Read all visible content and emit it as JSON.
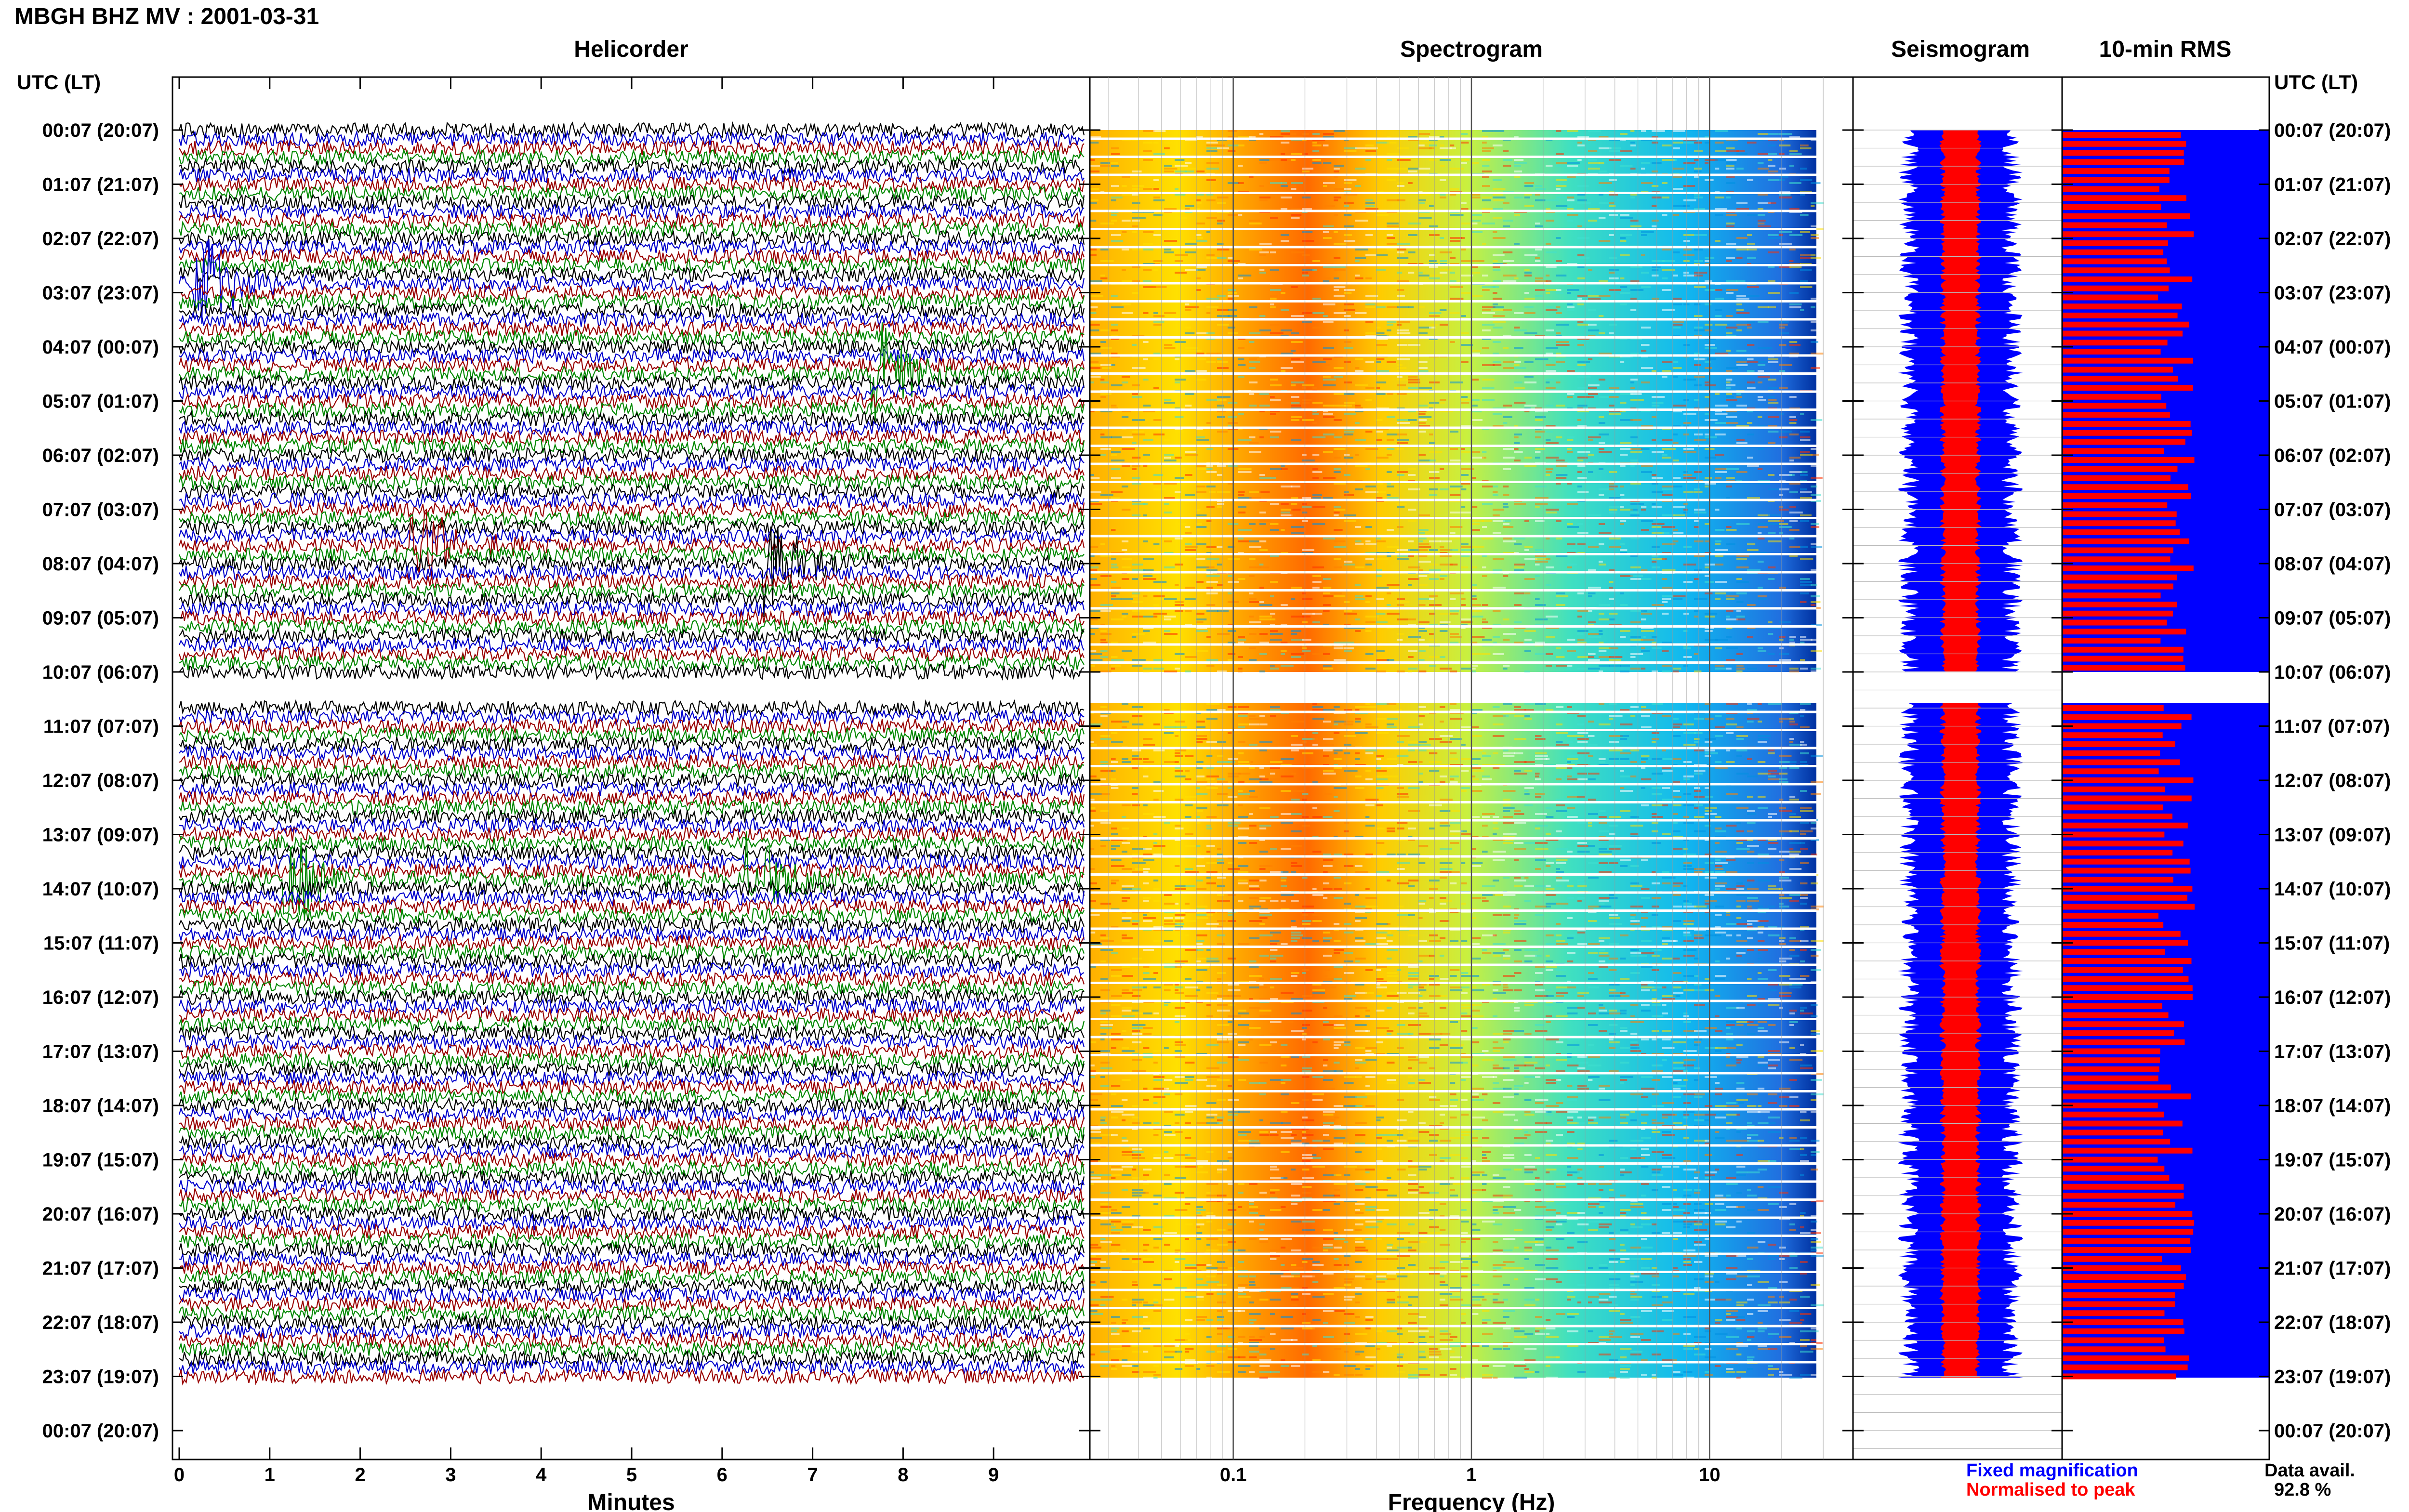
{
  "title": "MBGH BHZ MV : 2001-03-31",
  "panels": {
    "helicorder": "Helicorder",
    "spectrogram": "Spectrogram",
    "seismogram": "Seismogram",
    "rms": "10-min RMS"
  },
  "axis_header_left": "UTC (LT)",
  "axis_header_right": "UTC (LT)",
  "time_labels": [
    "00:07 (20:07)",
    "01:07 (21:07)",
    "02:07 (22:07)",
    "03:07 (23:07)",
    "04:07 (00:07)",
    "05:07 (01:07)",
    "06:07 (02:07)",
    "07:07 (03:07)",
    "08:07 (04:07)",
    "09:07 (05:07)",
    "10:07 (06:07)",
    "11:07 (07:07)",
    "12:07 (08:07)",
    "13:07 (09:07)",
    "14:07 (10:07)",
    "15:07 (11:07)",
    "16:07 (12:07)",
    "17:07 (13:07)",
    "18:07 (14:07)",
    "19:07 (15:07)",
    "20:07 (16:07)",
    "21:07 (17:07)",
    "22:07 (18:07)",
    "23:07 (19:07)",
    "00:07 (20:07)"
  ],
  "minute_ticks": [
    "0",
    "1",
    "2",
    "3",
    "4",
    "5",
    "6",
    "7",
    "8",
    "9"
  ],
  "xlabel_helicorder": "Minutes",
  "freq_ticks": [
    "0.1",
    "1",
    "10"
  ],
  "xlabel_spectrogram": "Frequency (Hz)",
  "legend": {
    "fixed": "Fixed magnification",
    "normalised": "Normalised to peak",
    "fixed_color": "#0000ff",
    "normalised_color": "#ff0000"
  },
  "availability": {
    "label": "Data avail.",
    "value": "92.8 %"
  },
  "colors": {
    "helicorder_traces": [
      "#000000",
      "#0000cc",
      "#990000",
      "#008800"
    ],
    "rms_fixed": "#0000ff",
    "rms_normalised": "#ff0000",
    "spectrogram_ramp": [
      "#ff7f00",
      "#ffd000",
      "#f0f000",
      "#60e880",
      "#00c8ff",
      "#0040c0"
    ]
  },
  "chart_data": {
    "type": "heatmap",
    "time_rows_hours": 24,
    "rows_per_hour": 6,
    "data_gap_hour_start": "10:07",
    "data_gap_hour_end": "10:37",
    "helicorder_xlim": [
      0,
      10
    ],
    "frequency_scale": "log",
    "frequency_xlim_hz": [
      0.025,
      40
    ],
    "rms_relative_fixed": 1.0,
    "rms_relative_normalised_typical": 0.55,
    "events_helicorder": [
      {
        "row_time": "07:47",
        "minute": 2.6
      },
      {
        "row_time": "13:57",
        "minute": 1.2
      },
      {
        "row_time": "13:57",
        "minute": 6.3
      },
      {
        "row_time": "02:57",
        "minute": 0.2
      },
      {
        "row_time": "04:37",
        "minute": 7.7
      },
      {
        "row_time": "08:07",
        "minute": 6.5
      }
    ]
  }
}
